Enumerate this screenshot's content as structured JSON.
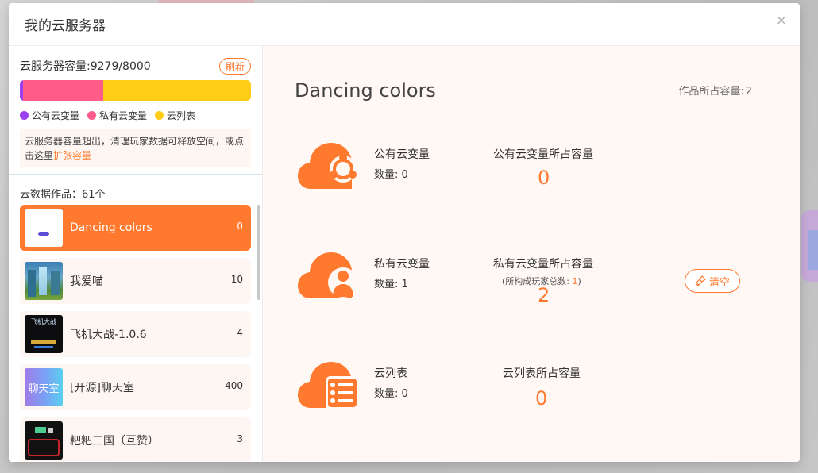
{
  "modal": {
    "title": "我的云服务器",
    "close_glyph": "×"
  },
  "capacity": {
    "label": "云服务器容量:",
    "used": "9279",
    "total": "8000",
    "display": "云服务器容量:9279/8000",
    "refresh_label": "刷新",
    "bar": {
      "public_fraction": 0.015,
      "private_fraction": 0.345,
      "list_fraction": 0.64
    },
    "legend": [
      {
        "label": "公有云变量",
        "color": "#9b3ff0"
      },
      {
        "label": "私有云变量",
        "color": "#ff5c8a"
      },
      {
        "label": "云列表",
        "color": "#ffcc16"
      }
    ],
    "notice_text": "云服务器容量超出，清理玩家数据可释放空间，或点击这里",
    "notice_link": "扩张容量"
  },
  "works": {
    "count_label": "云数据作品：61个",
    "items": [
      {
        "name": "Dancing colors",
        "num": "0",
        "active": true,
        "thumb": "white-card"
      },
      {
        "name": "我爱喵",
        "num": "10",
        "active": false,
        "thumb": "waterfall"
      },
      {
        "name": "飞机大战-1.0.6",
        "num": "4",
        "active": false,
        "thumb": "dark-game",
        "thumb_text": "飞机大战"
      },
      {
        "name": "[开源]聊天室",
        "num": "400",
        "active": false,
        "thumb": "gradient",
        "thumb_text": "聊天室"
      },
      {
        "name": "粑粑三国（互赞）",
        "num": "3",
        "active": false,
        "thumb": "dark-red"
      }
    ]
  },
  "detail": {
    "title": "Dancing colors",
    "work_capacity_label": "作品所占容量:",
    "work_capacity_value": "2",
    "rows": [
      {
        "label": "公有云变量",
        "count_label": "数量: 0",
        "cap_label": "公有云变量所占容量",
        "cap_value": "0",
        "icon": "cloud-share-icon"
      },
      {
        "label": "私有云变量",
        "count_label": "数量: 1",
        "cap_label": "私有云变量所占容量",
        "cap_sub_prefix": "(所构成玩家总数: ",
        "cap_sub_value": "1",
        "cap_sub_suffix": ")",
        "cap_value": "2",
        "icon": "cloud-user-icon"
      },
      {
        "label": "云列表",
        "count_label": "数量: 0",
        "cap_label": "云列表所占容量",
        "cap_value": "0",
        "icon": "cloud-list-icon"
      }
    ],
    "clear_label": "清空"
  },
  "colors": {
    "accent": "#ff7a2e",
    "panel_bg": "#fff8f5",
    "item_bg": "#fdf6f3"
  }
}
